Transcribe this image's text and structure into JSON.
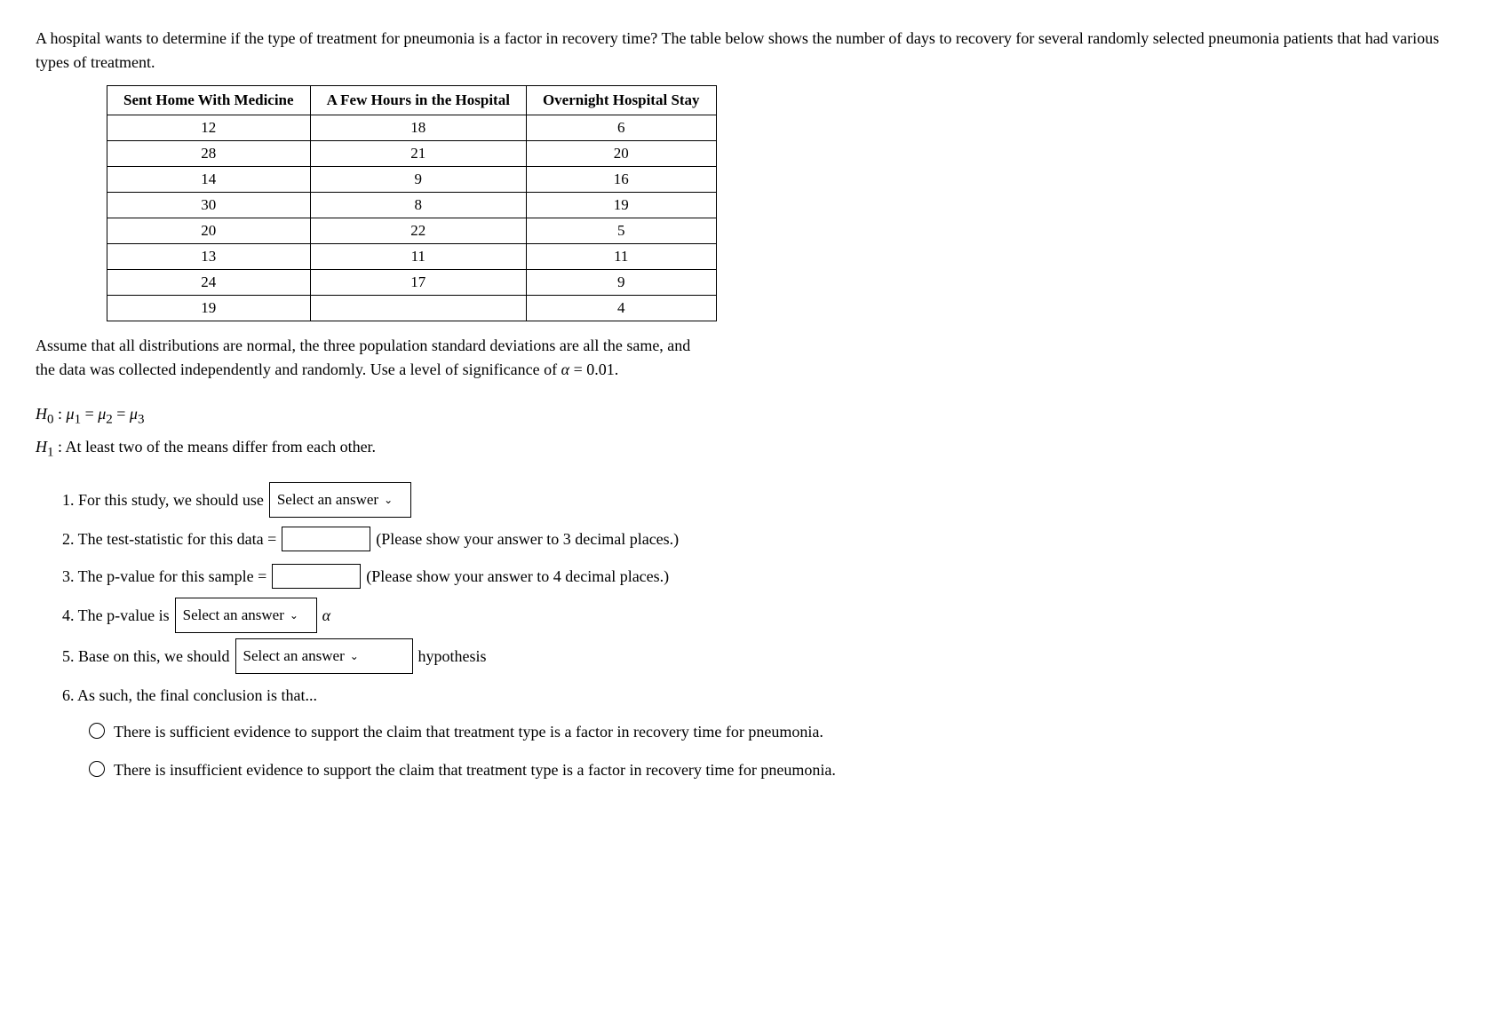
{
  "problem": {
    "description": "A hospital wants to determine if the type of treatment for pneumonia is a factor in recovery time? The table below shows the number of days to recovery for several randomly selected pneumonia patients that had various types of treatment.",
    "assumption": "Assume that all distributions are normal, the three population standard deviations are all the same, and the data was collected independently and randomly. Use a level of significance of α = 0.01.",
    "table": {
      "headers": [
        "Sent Home With Medicine",
        "A Few Hours in the Hospital",
        "Overnight Hospital Stay"
      ],
      "rows": [
        [
          "12",
          "18",
          "6"
        ],
        [
          "28",
          "21",
          "20"
        ],
        [
          "14",
          "9",
          "16"
        ],
        [
          "30",
          "8",
          "19"
        ],
        [
          "20",
          "22",
          "5"
        ],
        [
          "13",
          "11",
          "11"
        ],
        [
          "24",
          "17",
          "9"
        ],
        [
          "19",
          "",
          "4"
        ]
      ]
    },
    "hypothesis": {
      "h0": "H₀ : μ₁ = μ₂ = μ₃",
      "h1": "H₁ : At least two of the means differ from each other."
    },
    "questions": [
      {
        "number": "1.",
        "prefix": "For this study, we should use",
        "type": "dropdown",
        "dropdown_label": "Select an answer",
        "suffix": ""
      },
      {
        "number": "2.",
        "prefix": "The test-statistic for this data =",
        "type": "input",
        "suffix": "(Please show your answer to 3 decimal places.)"
      },
      {
        "number": "3.",
        "prefix": "The p-value for this sample =",
        "type": "input",
        "suffix": "(Please show your answer to 4 decimal places.)"
      },
      {
        "number": "4.",
        "prefix": "The p-value is",
        "type": "dropdown",
        "dropdown_label": "Select an answer",
        "suffix": "α"
      },
      {
        "number": "5.",
        "prefix": "Base on this, we should",
        "type": "dropdown",
        "dropdown_label": "Select an answer",
        "suffix": "hypothesis"
      },
      {
        "number": "6.",
        "prefix": "As such, the final conclusion is that...",
        "type": "label"
      }
    ],
    "conclusions": [
      "There is sufficient evidence to support the claim that treatment type is a factor in recovery time for pneumonia.",
      "There is insufficient evidence to support the claim that treatment type is a factor in recovery time for pneumonia."
    ]
  }
}
